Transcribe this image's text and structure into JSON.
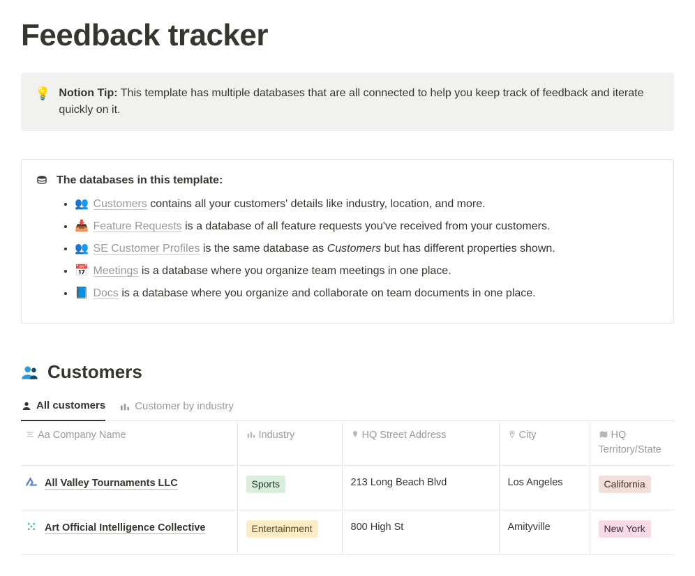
{
  "page_title": "Feedback tracker",
  "callout": {
    "icon": "💡",
    "bold": "Notion Tip:",
    "text": " This template has multiple databases that are all connected to help you keep track of feedback and iterate quickly on it."
  },
  "info": {
    "header": "The databases in this template:",
    "items": [
      {
        "icon": "👥",
        "link": "Customers",
        "rest": " contains all your customers' details like industry, location, and more."
      },
      {
        "icon": "📥",
        "link": "Feature Requests",
        "rest": " is a database of all feature requests you've received from your customers."
      },
      {
        "icon": "👥",
        "link": "SE Customer Profiles",
        "rest_before": " is the same database as ",
        "italic": "Customers",
        "rest_after": " but has different properties shown."
      },
      {
        "icon": "📅",
        "link": "Meetings",
        "rest": " is a database where you organize team meetings in one place."
      },
      {
        "icon": "📘",
        "link": "Docs",
        "rest": " is a database where you organize and collaborate on team documents in one place."
      }
    ]
  },
  "customers": {
    "title": "Customers",
    "tabs": {
      "active": "All customers",
      "inactive": "Customer by industry"
    },
    "columns": {
      "company": "Company Name",
      "industry": "Industry",
      "address": "HQ Street Address",
      "city": "City",
      "territory": "HQ Territory/State"
    },
    "rows": [
      {
        "company": "All Valley Tournaments LLC",
        "industry": "Sports",
        "industry_class": "tag-green",
        "address": "213 Long Beach Blvd",
        "city": "Los Angeles",
        "territory": "California",
        "territory_class": "tag-pinkish"
      },
      {
        "company": "Art Official Intelligence Collective",
        "industry": "Entertainment",
        "industry_class": "tag-yellow",
        "address": "800 High St",
        "city": "Amityville",
        "territory": "New York",
        "territory_class": "tag-pink"
      }
    ]
  }
}
